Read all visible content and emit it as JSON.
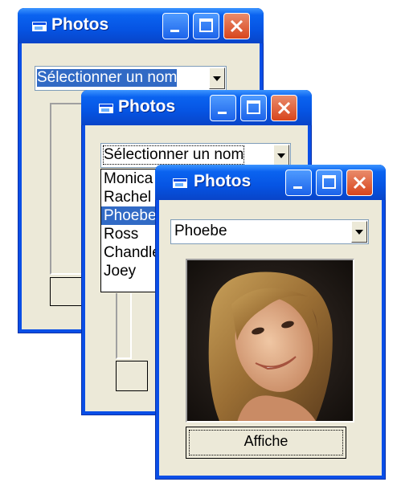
{
  "window_title": "Photos",
  "combo_placeholder": "Sélectionner un nom",
  "names": [
    "Monica",
    "Rachel",
    "Phoebe",
    "Ross",
    "Chandler",
    "Joey"
  ],
  "selected_name": "Phoebe",
  "selected_index": 2,
  "show_button_label": "Affiche",
  "icons": {
    "app": "photos-window-icon",
    "minimize": "minimize-icon",
    "maximize": "maximize-icon",
    "close": "close-icon",
    "dropdown": "chevron-down-icon"
  },
  "colors": {
    "titlebar": "#0654e3",
    "client": "#ece9d8",
    "selection": "#316ac5",
    "close_button": "#d8451d"
  }
}
